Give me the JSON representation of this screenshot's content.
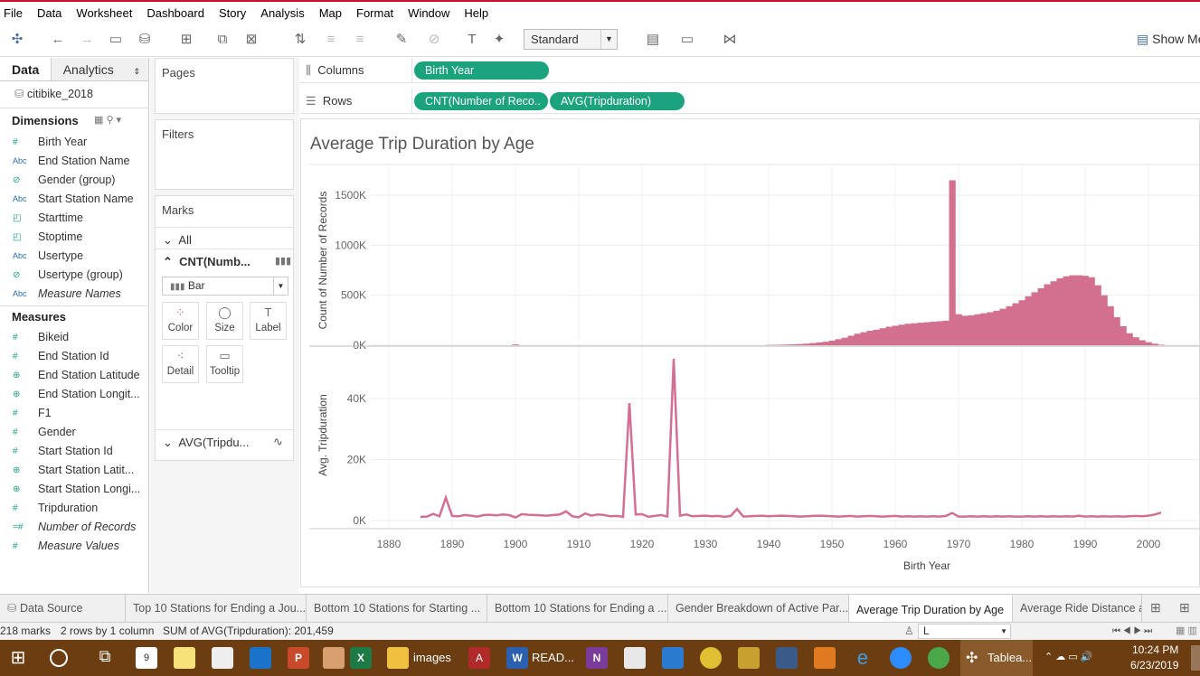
{
  "menu": [
    "File",
    "Data",
    "Worksheet",
    "Dashboard",
    "Story",
    "Analysis",
    "Map",
    "Format",
    "Window",
    "Help"
  ],
  "toolbar": {
    "standard": "Standard",
    "show_me": "Show Me"
  },
  "left_pane": {
    "tab_data": "Data",
    "tab_analytics": "Analytics",
    "datasource": "citibike_2018",
    "dimensions_title": "Dimensions",
    "dimensions": [
      {
        "type": "#",
        "name": "Birth Year"
      },
      {
        "type": "Abc",
        "name": "End Station Name"
      },
      {
        "type": "clip",
        "name": "Gender (group)"
      },
      {
        "type": "Abc",
        "name": "Start Station Name"
      },
      {
        "type": "cal",
        "name": "Starttime"
      },
      {
        "type": "cal",
        "name": "Stoptime"
      },
      {
        "type": "Abc",
        "name": "Usertype"
      },
      {
        "type": "clip",
        "name": "Usertype (group)"
      },
      {
        "type": "Abc",
        "name": "Measure Names"
      }
    ],
    "measures_title": "Measures",
    "measures": [
      {
        "type": "#",
        "name": "Bikeid"
      },
      {
        "type": "#",
        "name": "End Station Id"
      },
      {
        "type": "globe",
        "name": "End Station Latitude"
      },
      {
        "type": "globe",
        "name": "End Station Longit..."
      },
      {
        "type": "#",
        "name": "F1"
      },
      {
        "type": "#",
        "name": "Gender"
      },
      {
        "type": "#",
        "name": "Start Station Id"
      },
      {
        "type": "globe",
        "name": "Start Station Latit..."
      },
      {
        "type": "globe",
        "name": "Start Station Longi..."
      },
      {
        "type": "#",
        "name": "Tripduration"
      },
      {
        "type": "=#",
        "name": "Number of Records"
      },
      {
        "type": "#",
        "name": "Measure Values"
      }
    ]
  },
  "cards": {
    "pages": "Pages",
    "filters": "Filters",
    "marks": "Marks",
    "all": "All",
    "cnt": "CNT(Numb...",
    "mark_type": "Bar",
    "color": "Color",
    "size": "Size",
    "label": "Label",
    "detail": "Detail",
    "tooltip": "Tooltip",
    "avg": "AVG(Tripdu..."
  },
  "shelves": {
    "columns_label": "Columns",
    "rows_label": "Rows",
    "col_pill": "Birth Year",
    "row_pill1": "CNT(Number of Reco..",
    "row_pill2": "AVG(Tripduration)"
  },
  "chart_data": {
    "type": "bar",
    "title": "Average Trip Duration by Age",
    "xlabel": "Birth Year",
    "x_ticks": [
      1880,
      1890,
      1900,
      1910,
      1920,
      1930,
      1940,
      1950,
      1960,
      1970,
      1980,
      1990,
      2000
    ],
    "xlim": [
      1877,
      2008
    ],
    "color": "#d4708f",
    "panes": [
      {
        "type": "bar",
        "ylabel": "Count of Number of Records",
        "y_ticks": [
          "0K",
          "500K",
          "1000K",
          "1500K"
        ],
        "y_tick_values": [
          0,
          500000,
          1000000,
          1500000
        ],
        "ylim": [
          0,
          1700000
        ],
        "x": [
          1900,
          1940,
          1941,
          1942,
          1943,
          1944,
          1945,
          1946,
          1947,
          1948,
          1949,
          1950,
          1951,
          1952,
          1953,
          1954,
          1955,
          1956,
          1957,
          1958,
          1959,
          1960,
          1961,
          1962,
          1963,
          1964,
          1965,
          1966,
          1967,
          1968,
          1969,
          1970,
          1971,
          1972,
          1973,
          1974,
          1975,
          1976,
          1977,
          1978,
          1979,
          1980,
          1981,
          1982,
          1983,
          1984,
          1985,
          1986,
          1987,
          1988,
          1989,
          1990,
          1991,
          1992,
          1993,
          1994,
          1995,
          1996,
          1997,
          1998,
          1999,
          2000,
          2001,
          2002
        ],
        "values": [
          8000,
          3000,
          4000,
          5000,
          7000,
          9000,
          12000,
          16000,
          22000,
          28000,
          35000,
          45000,
          60000,
          75000,
          95000,
          115000,
          130000,
          145000,
          155000,
          170000,
          185000,
          195000,
          205000,
          215000,
          220000,
          225000,
          230000,
          235000,
          240000,
          245000,
          1650000,
          310000,
          295000,
          300000,
          310000,
          320000,
          330000,
          345000,
          365000,
          390000,
          420000,
          450000,
          490000,
          530000,
          570000,
          610000,
          640000,
          670000,
          690000,
          700000,
          700000,
          695000,
          680000,
          600000,
          500000,
          390000,
          280000,
          190000,
          120000,
          80000,
          50000,
          30000,
          15000,
          5000
        ]
      },
      {
        "type": "line",
        "ylabel": "Avg. Tripduration",
        "y_ticks": [
          "0K",
          "20K",
          "40K"
        ],
        "y_tick_values": [
          0,
          20000,
          40000
        ],
        "ylim": [
          0,
          56000
        ],
        "x": [
          1885,
          1886,
          1887,
          1888,
          1889,
          1890,
          1891,
          1892,
          1893,
          1894,
          1895,
          1896,
          1897,
          1898,
          1899,
          1900,
          1901,
          1902,
          1903,
          1904,
          1905,
          1906,
          1907,
          1908,
          1909,
          1910,
          1911,
          1912,
          1913,
          1914,
          1915,
          1916,
          1917,
          1918,
          1919,
          1920,
          1921,
          1922,
          1923,
          1924,
          1925,
          1926,
          1927,
          1928,
          1929,
          1930,
          1931,
          1932,
          1933,
          1934,
          1935,
          1936,
          1937,
          1938,
          1939,
          1940,
          1941,
          1942,
          1943,
          1944,
          1945,
          1946,
          1947,
          1948,
          1949,
          1950,
          1951,
          1952,
          1953,
          1954,
          1955,
          1956,
          1957,
          1958,
          1959,
          1960,
          1961,
          1962,
          1963,
          1964,
          1965,
          1966,
          1967,
          1968,
          1969,
          1970,
          1971,
          1972,
          1973,
          1974,
          1975,
          1976,
          1977,
          1978,
          1979,
          1980,
          1981,
          1982,
          1983,
          1984,
          1985,
          1986,
          1987,
          1988,
          1989,
          1990,
          1991,
          1992,
          1993,
          1994,
          1995,
          1996,
          1997,
          1998,
          1999,
          2000,
          2001,
          2002
        ],
        "values": [
          1200,
          1300,
          2200,
          1400,
          7500,
          1500,
          1400,
          1800,
          1600,
          1300,
          1800,
          1900,
          1700,
          2000,
          1800,
          1000,
          2100,
          1900,
          1800,
          1700,
          1600,
          1800,
          2000,
          3000,
          1400,
          1100,
          2300,
          1600,
          2000,
          1800,
          1400,
          1500,
          1200,
          38500,
          2000,
          2100,
          1200,
          1500,
          1800,
          1300,
          53000,
          1600,
          2000,
          1400,
          1500,
          1600,
          1400,
          1500,
          1200,
          1500,
          3800,
          1300,
          1400,
          1500,
          1600,
          1400,
          1500,
          1600,
          1500,
          1400,
          1300,
          1400,
          1500,
          1600,
          1500,
          1400,
          1300,
          1400,
          1500,
          1300,
          1400,
          1500,
          1400,
          1300,
          1400,
          1500,
          1300,
          1400,
          1300,
          1400,
          1300,
          1400,
          1300,
          1500,
          2500,
          1300,
          1300,
          1400,
          1300,
          1400,
          1300,
          1400,
          1300,
          1400,
          1300,
          1300,
          1400,
          1300,
          1400,
          1300,
          1400,
          1300,
          1400,
          1300,
          1600,
          1300,
          1400,
          1300,
          1400,
          1300,
          1400,
          1300,
          1400,
          1500,
          1400,
          1600,
          2000,
          2600
        ]
      }
    ]
  },
  "sheet_tabs": [
    "Data Source",
    "Top 10 Stations for Ending a Jou...",
    "Bottom 10 Stations for Starting ...",
    "Bottom 10 Stations for Ending a ...",
    "Gender Breakdown of Active Par...",
    "Average Trip Duration by Age",
    "Average Ride Distance a"
  ],
  "status": {
    "marks": "218 marks",
    "rows": "2 rows by 1 column",
    "sum": "SUM of AVG(Tripduration): 201,459",
    "user": "L"
  },
  "taskbar": {
    "images": "images",
    "read": "READ...",
    "tableau": "Tablea...",
    "time": "10:24 PM",
    "date": "6/23/2019"
  }
}
